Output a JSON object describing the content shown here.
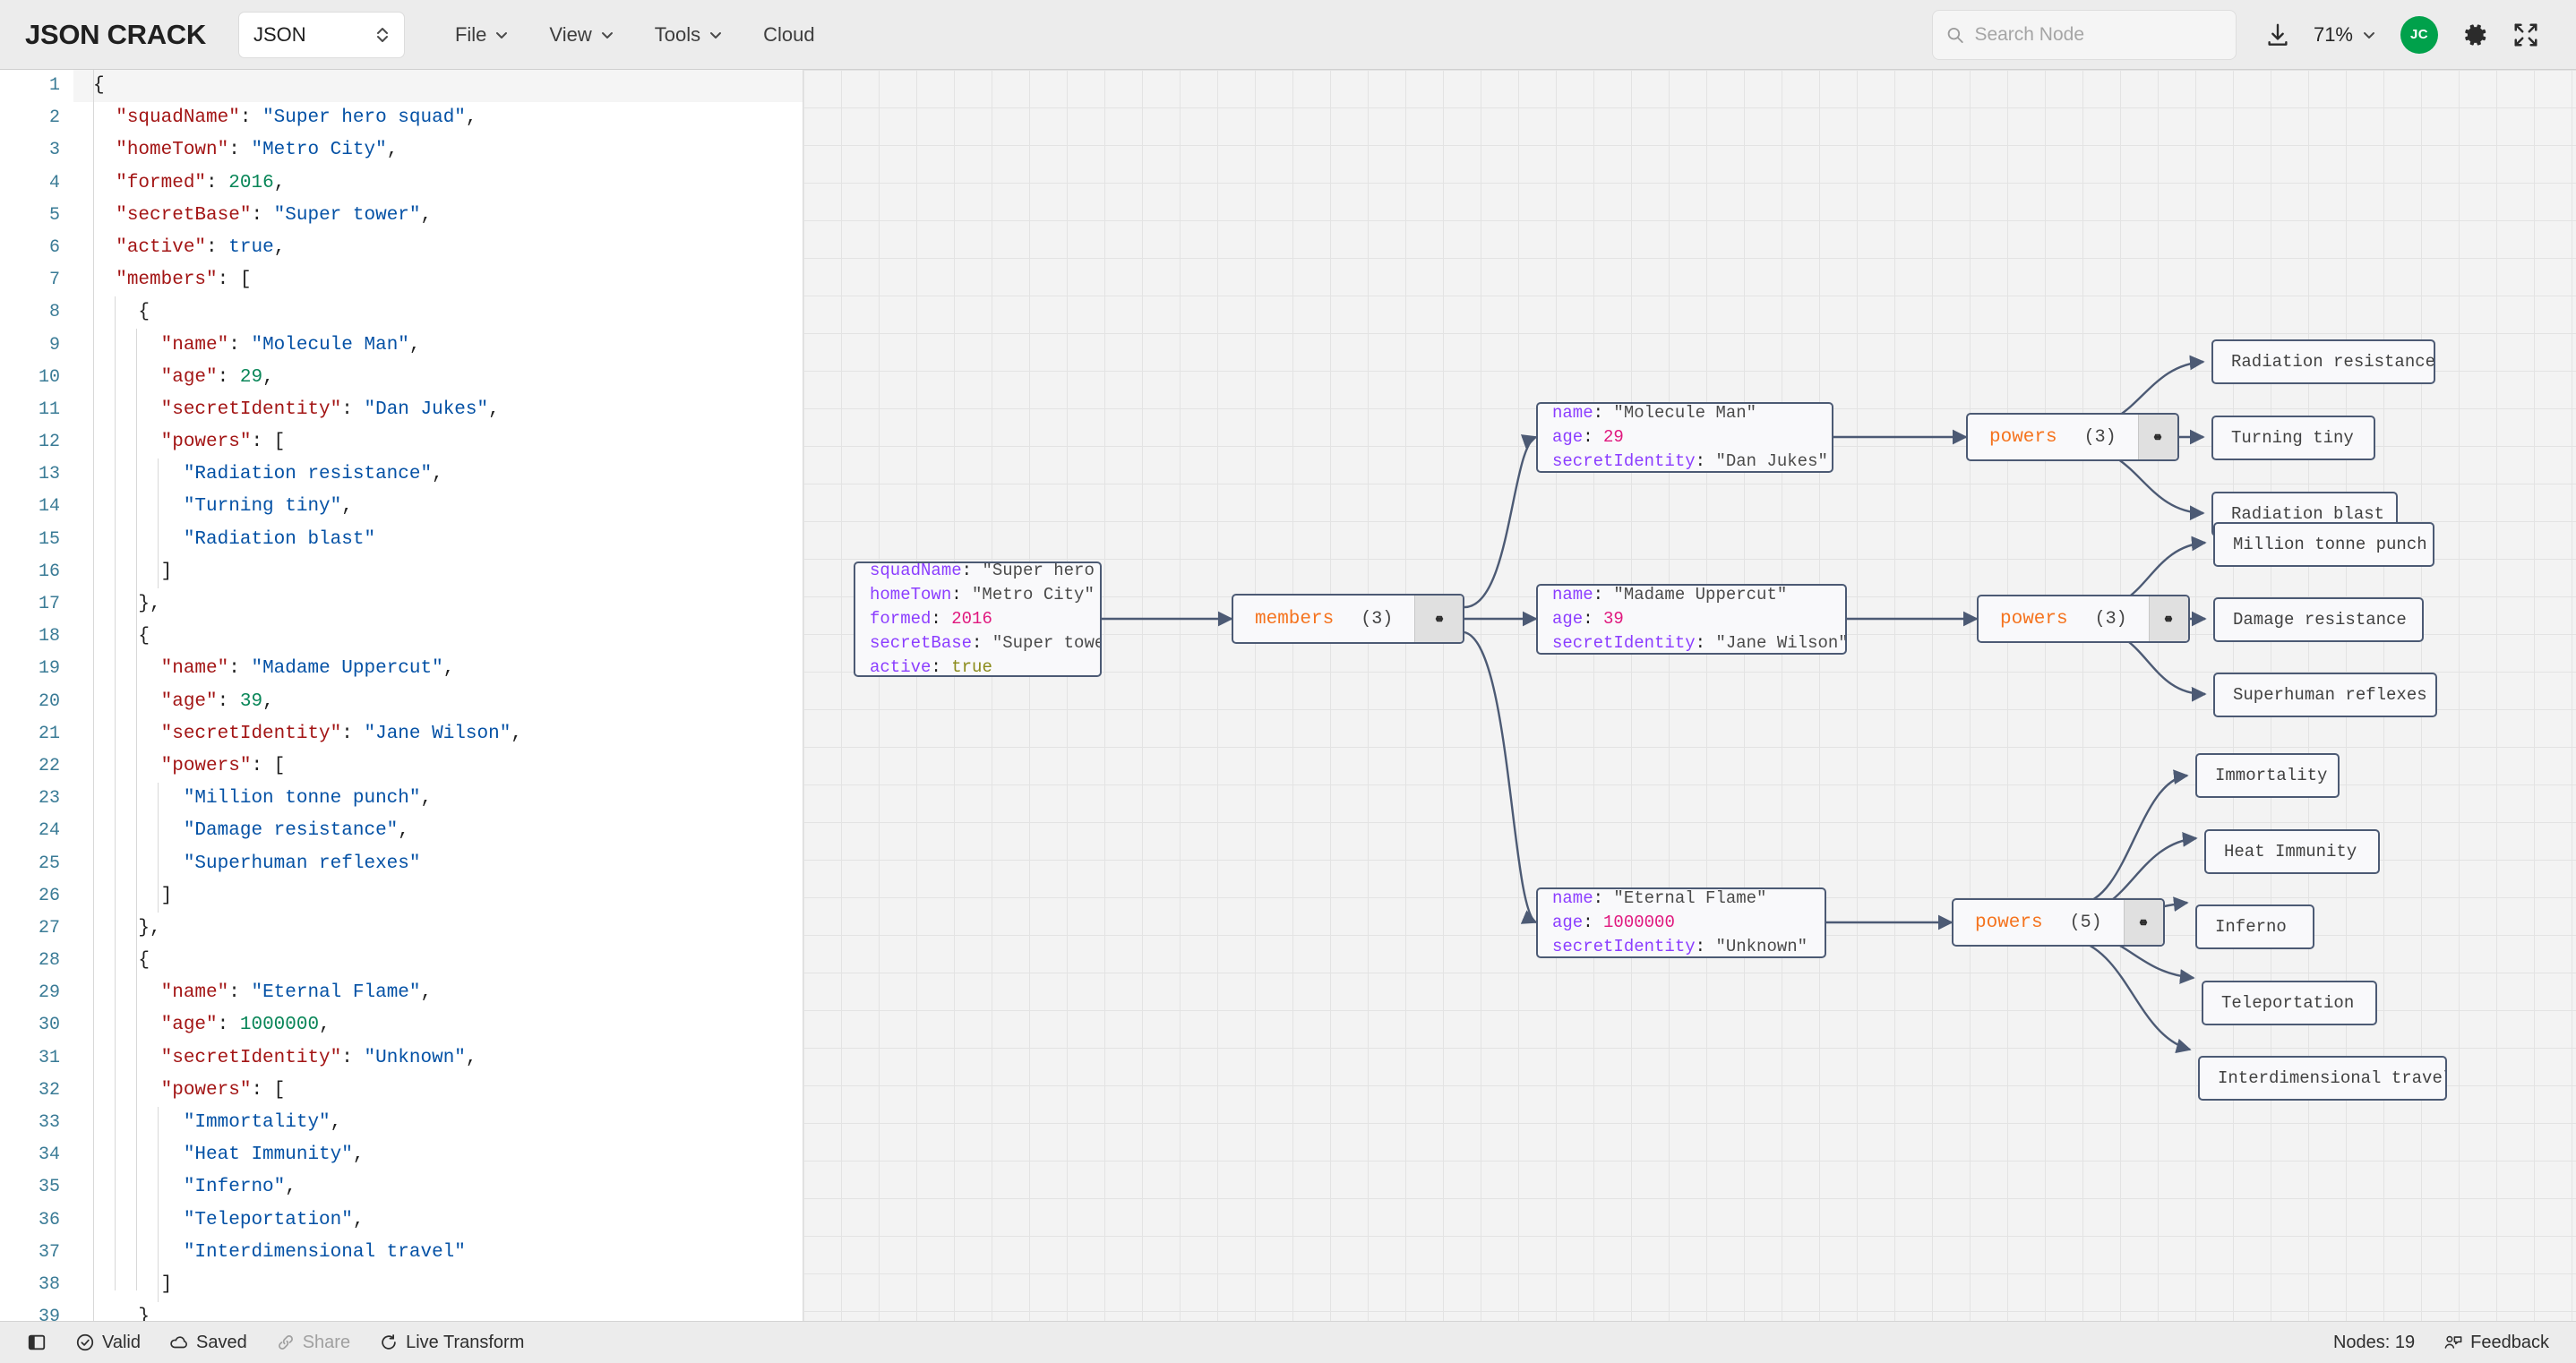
{
  "toolbar": {
    "brand": "JSON CRACK",
    "format_value": "JSON",
    "menus": [
      {
        "label": "File",
        "has_caret": true
      },
      {
        "label": "View",
        "has_caret": true
      },
      {
        "label": "Tools",
        "has_caret": true
      },
      {
        "label": "Cloud",
        "has_caret": false
      }
    ],
    "search_placeholder": "Search Node",
    "search_value": "",
    "download_icon": "download-icon",
    "zoom_level": "71%",
    "avatar_initials": "JC",
    "avatar_color": "#00a14b",
    "gear_icon": "gear-icon",
    "fullscreen_icon": "fullscreen-icon"
  },
  "editor": {
    "lines": [
      {
        "num": "1",
        "active": true,
        "text": "{"
      },
      {
        "num": "2",
        "active": false,
        "text": "  \"squadName\": \"Super hero squad\","
      },
      {
        "num": "3",
        "active": false,
        "text": "  \"homeTown\": \"Metro City\","
      },
      {
        "num": "4",
        "active": false,
        "text": "  \"formed\": 2016,"
      },
      {
        "num": "5",
        "active": false,
        "text": "  \"secretBase\": \"Super tower\","
      },
      {
        "num": "6",
        "active": false,
        "text": "  \"active\": true,"
      },
      {
        "num": "7",
        "active": false,
        "text": "  \"members\": ["
      },
      {
        "num": "8",
        "active": false,
        "text": "    {"
      },
      {
        "num": "9",
        "active": false,
        "text": "      \"name\": \"Molecule Man\","
      },
      {
        "num": "10",
        "active": false,
        "text": "      \"age\": 29,"
      },
      {
        "num": "11",
        "active": false,
        "text": "      \"secretIdentity\": \"Dan Jukes\","
      },
      {
        "num": "12",
        "active": false,
        "text": "      \"powers\": ["
      },
      {
        "num": "13",
        "active": false,
        "text": "        \"Radiation resistance\","
      },
      {
        "num": "14",
        "active": false,
        "text": "        \"Turning tiny\","
      },
      {
        "num": "15",
        "active": false,
        "text": "        \"Radiation blast\""
      },
      {
        "num": "16",
        "active": false,
        "text": "      ]"
      },
      {
        "num": "17",
        "active": false,
        "text": "    },"
      },
      {
        "num": "18",
        "active": false,
        "text": "    {"
      },
      {
        "num": "19",
        "active": false,
        "text": "      \"name\": \"Madame Uppercut\","
      },
      {
        "num": "20",
        "active": false,
        "text": "      \"age\": 39,"
      },
      {
        "num": "21",
        "active": false,
        "text": "      \"secretIdentity\": \"Jane Wilson\","
      },
      {
        "num": "22",
        "active": false,
        "text": "      \"powers\": ["
      },
      {
        "num": "23",
        "active": false,
        "text": "        \"Million tonne punch\","
      },
      {
        "num": "24",
        "active": false,
        "text": "        \"Damage resistance\","
      },
      {
        "num": "25",
        "active": false,
        "text": "        \"Superhuman reflexes\""
      },
      {
        "num": "26",
        "active": false,
        "text": "      ]"
      },
      {
        "num": "27",
        "active": false,
        "text": "    },"
      },
      {
        "num": "28",
        "active": false,
        "text": "    {"
      },
      {
        "num": "29",
        "active": false,
        "text": "      \"name\": \"Eternal Flame\","
      },
      {
        "num": "30",
        "active": false,
        "text": "      \"age\": 1000000,"
      },
      {
        "num": "31",
        "active": false,
        "text": "      \"secretIdentity\": \"Unknown\","
      },
      {
        "num": "32",
        "active": false,
        "text": "      \"powers\": ["
      },
      {
        "num": "33",
        "active": false,
        "text": "        \"Immortality\","
      },
      {
        "num": "34",
        "active": false,
        "text": "        \"Heat Immunity\","
      },
      {
        "num": "35",
        "active": false,
        "text": "        \"Inferno\","
      },
      {
        "num": "36",
        "active": false,
        "text": "        \"Teleportation\","
      },
      {
        "num": "37",
        "active": false,
        "text": "        \"Interdimensional travel\""
      },
      {
        "num": "38",
        "active": false,
        "text": "      ]"
      },
      {
        "num": "39",
        "active": false,
        "text": "    }"
      }
    ]
  },
  "graph": {
    "root_node": {
      "rows": [
        {
          "key": "squadName",
          "value": "\"Super hero squad\"",
          "type": "string"
        },
        {
          "key": "homeTown",
          "value": "\"Metro City\"",
          "type": "string"
        },
        {
          "key": "formed",
          "value": "2016",
          "type": "number"
        },
        {
          "key": "secretBase",
          "value": "\"Super tower\"",
          "type": "string"
        },
        {
          "key": "active",
          "value": "true",
          "type": "boolean"
        }
      ]
    },
    "members_node": {
      "label": "members",
      "count": "(3)",
      "link_icon": "link-icon"
    },
    "member_nodes": [
      {
        "rows": [
          {
            "key": "name",
            "value": "\"Molecule Man\"",
            "type": "string"
          },
          {
            "key": "age",
            "value": "29",
            "type": "number"
          },
          {
            "key": "secretIdentity",
            "value": "\"Dan Jukes\"",
            "type": "string"
          }
        ]
      },
      {
        "rows": [
          {
            "key": "name",
            "value": "\"Madame Uppercut\"",
            "type": "string"
          },
          {
            "key": "age",
            "value": "39",
            "type": "number"
          },
          {
            "key": "secretIdentity",
            "value": "\"Jane Wilson\"",
            "type": "string"
          }
        ]
      },
      {
        "rows": [
          {
            "key": "name",
            "value": "\"Eternal Flame\"",
            "type": "string"
          },
          {
            "key": "age",
            "value": "1000000",
            "type": "number"
          },
          {
            "key": "secretIdentity",
            "value": "\"Unknown\"",
            "type": "string"
          }
        ]
      }
    ],
    "powers_nodes": [
      {
        "label": "powers",
        "count": "(3)",
        "link_icon": "link-icon"
      },
      {
        "label": "powers",
        "count": "(3)",
        "link_icon": "link-icon"
      },
      {
        "label": "powers",
        "count": "(5)",
        "link_icon": "link-icon"
      }
    ],
    "leaf_nodes": [
      "Radiation resistance",
      "Turning tiny",
      "Radiation blast",
      "Million tonne punch",
      "Damage resistance",
      "Superhuman reflexes",
      "Immortality",
      "Heat Immunity",
      "Inferno",
      "Teleportation",
      "Interdimensional travel"
    ],
    "edge_color": "#4c5a74",
    "node_border_color": "#4c5a74"
  },
  "statusbar": {
    "sidebar_toggle_icon": "sidebar-toggle-icon",
    "items": [
      {
        "label": "Valid",
        "icon": "check-circle-icon",
        "muted": false
      },
      {
        "label": "Saved",
        "icon": "cloud-icon",
        "muted": false
      },
      {
        "label": "Share",
        "icon": "link-icon",
        "muted": true
      },
      {
        "label": "Live Transform",
        "icon": "refresh-icon",
        "muted": false
      }
    ],
    "nodes_count": "Nodes: 19",
    "feedback_label": "Feedback",
    "feedback_icon": "feedback-icon"
  }
}
